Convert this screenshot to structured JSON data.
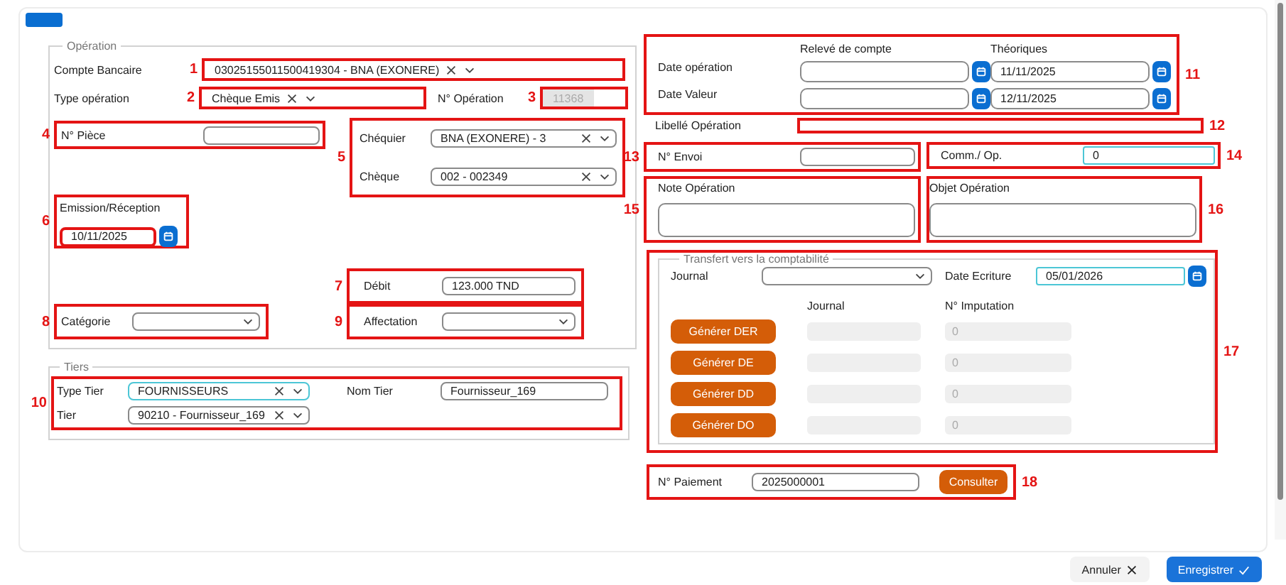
{
  "operation": {
    "legend": "Opération",
    "compte": {
      "label": "Compte Bancaire",
      "value": "03025155011500419304 - BNA (EXONERE)",
      "annotation": {
        "number": "1"
      }
    },
    "type": {
      "label": "Type opération",
      "value": "Chèque Emis",
      "annotation": {
        "number": "2"
      }
    },
    "num_op": {
      "label": "N° Opération",
      "value": "11368",
      "disabled": true,
      "annotation": {
        "number": "3"
      }
    },
    "piece": {
      "label": "N° Pièce",
      "annotation": {
        "number": "4"
      }
    },
    "chequier": {
      "label": "Chéquier",
      "value": "BNA (EXONERE) - 3"
    },
    "cheque": {
      "label": "Chèque",
      "value": "002 - 002349"
    },
    "cheque_annotation": {
      "number": "5"
    },
    "emission": {
      "label": "Emission/Réception",
      "value": "10/11/2025",
      "annotation": {
        "number": "6"
      }
    },
    "debit": {
      "label": "Débit",
      "value": "123.000 TND",
      "annotation": {
        "number": "7"
      }
    },
    "categorie": {
      "label": "Catégorie",
      "annotation": {
        "number": "8"
      }
    },
    "affectation": {
      "label": "Affectation",
      "annotation": {
        "number": "9"
      }
    }
  },
  "tiers": {
    "legend": "Tiers",
    "annotation": {
      "number": "10"
    },
    "type_tier": {
      "label": "Type Tier",
      "value": "FOURNISSEURS",
      "focused": true
    },
    "tier": {
      "label": "Tier",
      "value": "90210 - Fournisseur_169",
      "focused": false
    },
    "nom_tier": {
      "label": "Nom Tier",
      "value": "Fournisseur_169"
    }
  },
  "dates": {
    "annotation": {
      "number": "11"
    },
    "headers": [
      "Relevé de compte",
      "Théoriques"
    ],
    "rows": [
      {
        "label": "Date opération",
        "theorique": "11/11/2025"
      },
      {
        "label": "Date Valeur",
        "theorique": "12/11/2025"
      }
    ]
  },
  "libelle": {
    "label": "Libellé Opération",
    "annotation": {
      "number": "12"
    }
  },
  "envoi": {
    "label": "N° Envoi",
    "annotation": {
      "number": "13"
    }
  },
  "comm": {
    "label": "Comm./ Op.",
    "value": "0",
    "focused": true,
    "annotation": {
      "number": "14"
    }
  },
  "note": {
    "label": "Note Opération",
    "annotation": {
      "number": "15"
    }
  },
  "objet": {
    "label": "Objet Opération",
    "annotation": {
      "number": "16"
    }
  },
  "transfert": {
    "legend": "Transfert vers la comptabilité",
    "annotation": {
      "number": "17"
    },
    "journal_label": "Journal",
    "date_label": "Date Ecriture",
    "date_value": "05/01/2026",
    "date_focused": true,
    "col_journal": "Journal",
    "col_imputation": "N° Imputation",
    "rows": [
      {
        "button": "Générer DER",
        "imputation": "0"
      },
      {
        "button": "Générer DE",
        "imputation": "0"
      },
      {
        "button": "Générer DD",
        "imputation": "0"
      },
      {
        "button": "Générer DO",
        "imputation": "0"
      }
    ]
  },
  "paiement": {
    "label": "N° Paiement",
    "value": "2025000001",
    "button": "Consulter",
    "annotation": {
      "number": "18"
    }
  },
  "footer": [
    {
      "label": "Annuler",
      "kind": "cancel"
    },
    {
      "label": "Enregistrer",
      "kind": "save"
    }
  ]
}
